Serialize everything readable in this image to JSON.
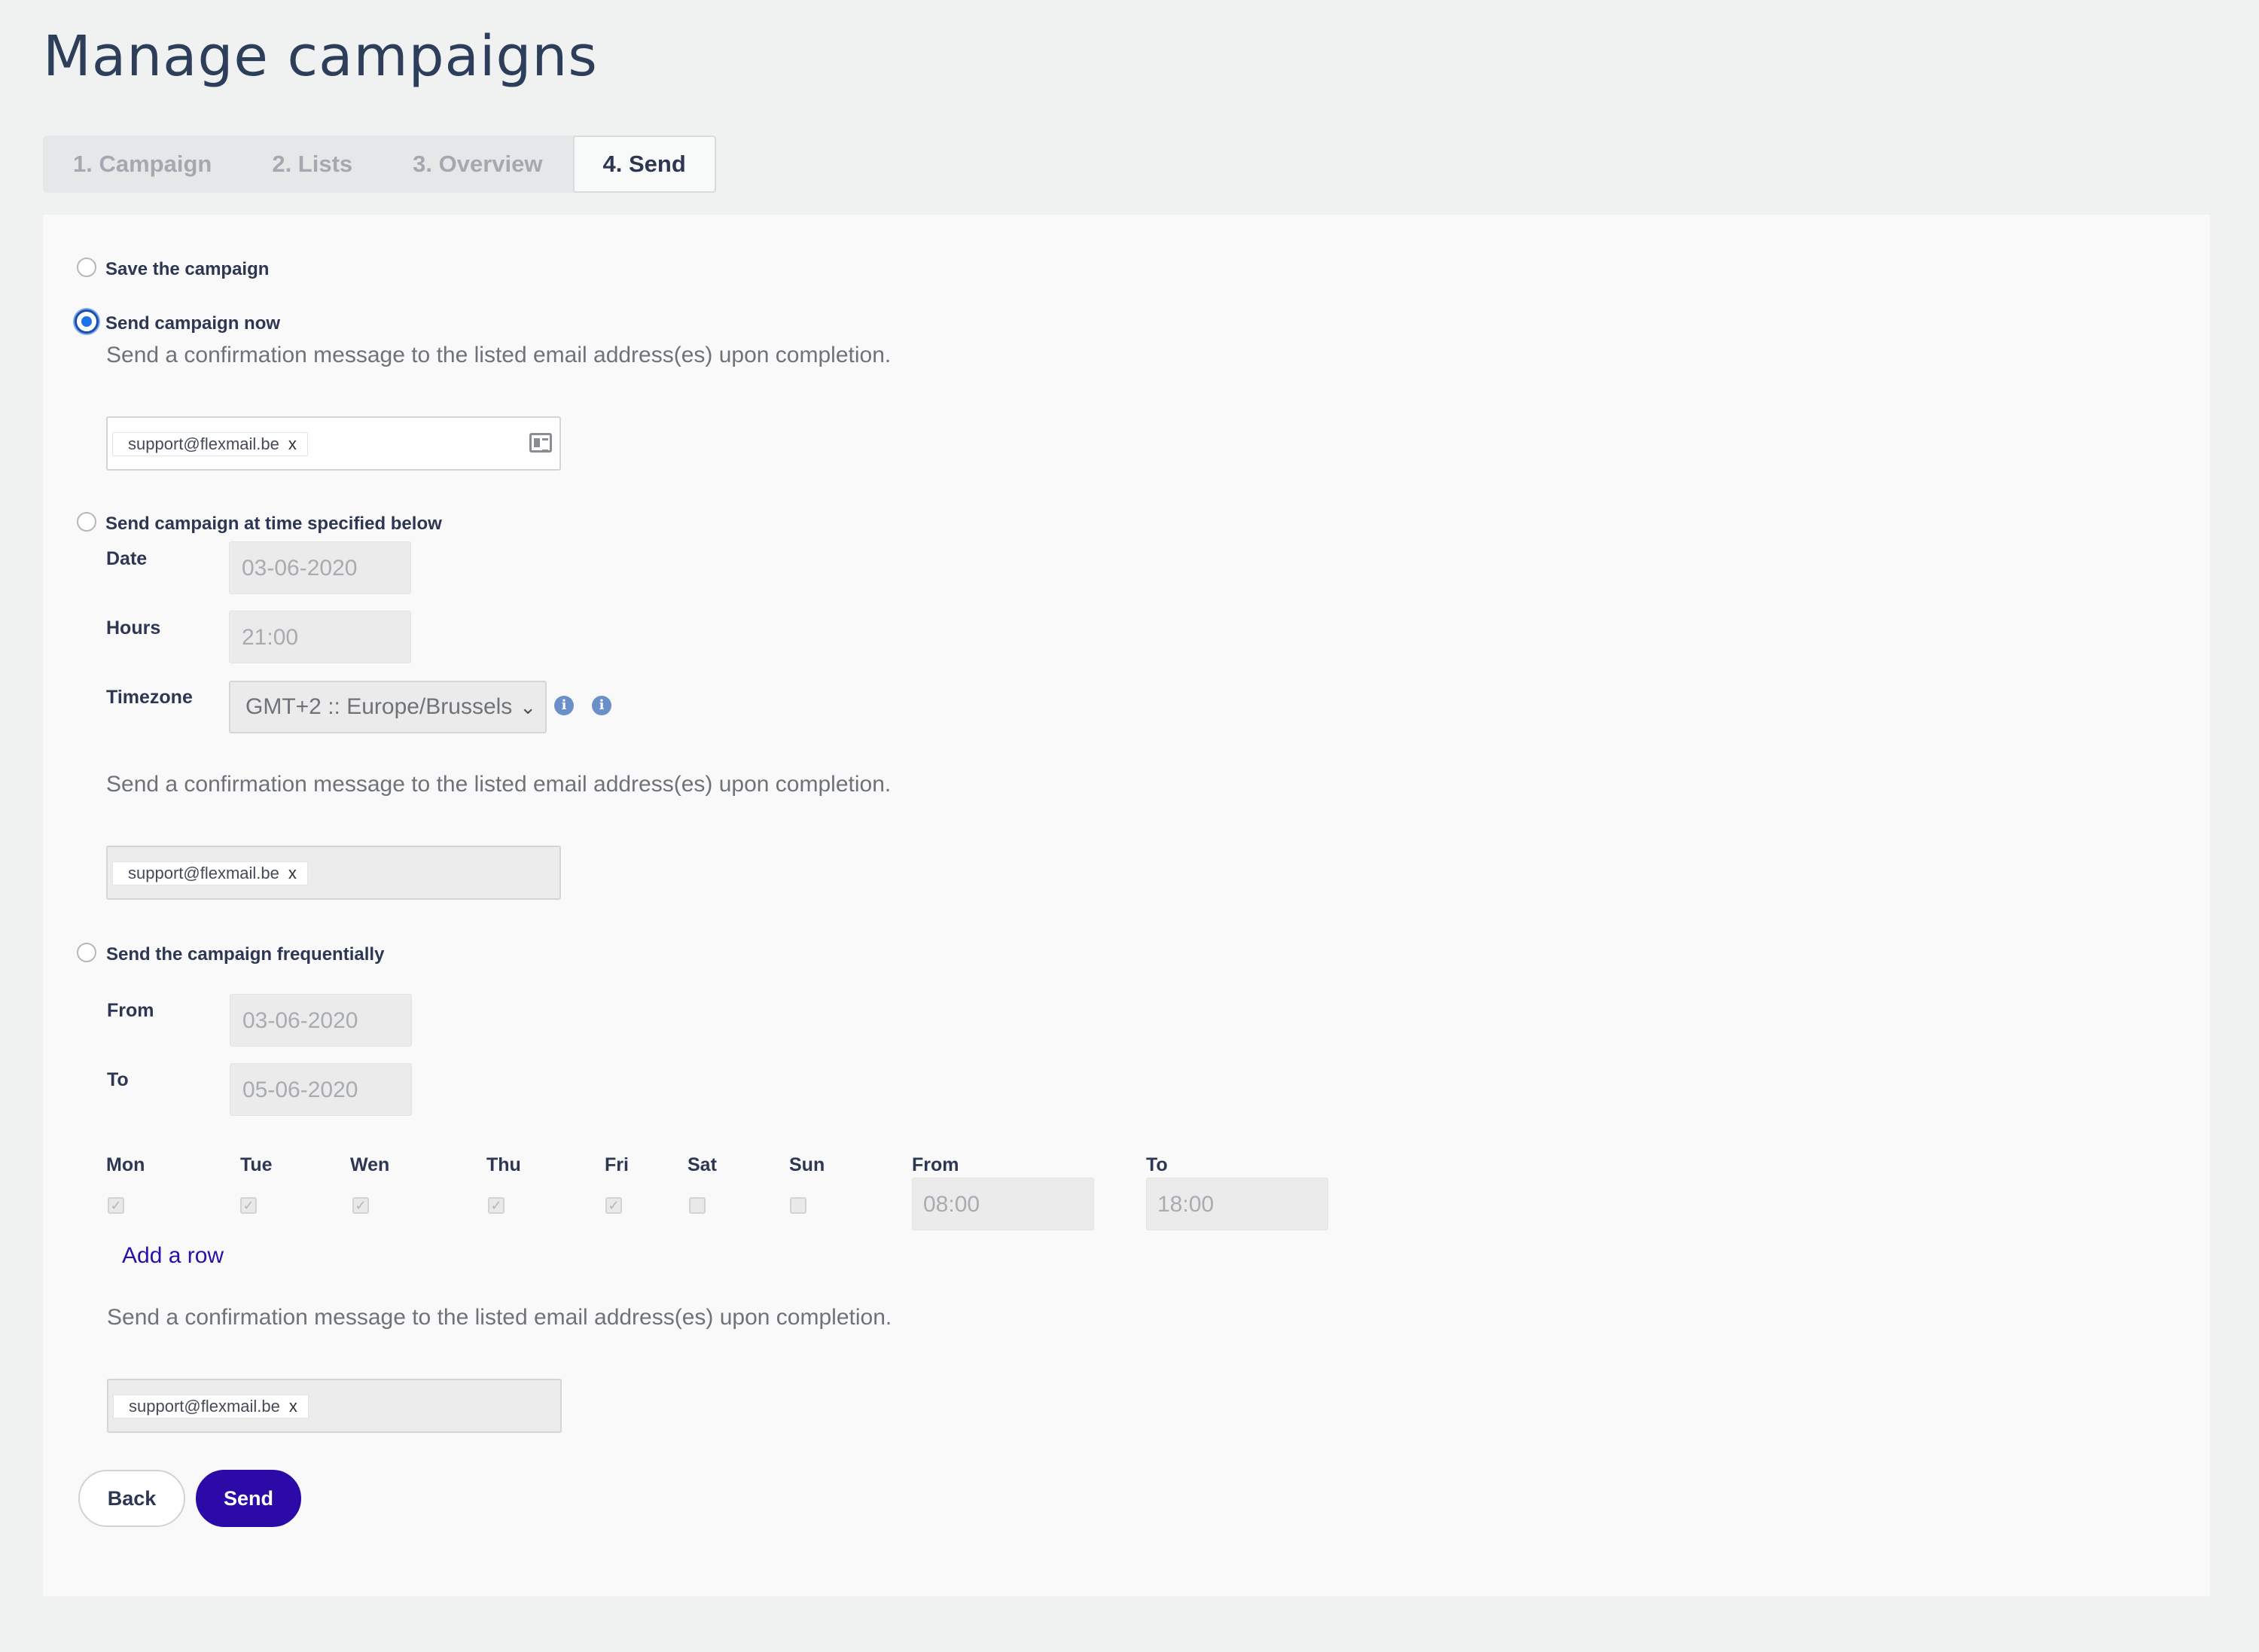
{
  "page": {
    "title": "Manage campaigns"
  },
  "tabs": [
    {
      "label": "1. Campaign",
      "active": false
    },
    {
      "label": "2. Lists",
      "active": false
    },
    {
      "label": "3. Overview",
      "active": false
    },
    {
      "label": "4. Send",
      "active": true
    }
  ],
  "options": {
    "save": {
      "label": "Save the campaign",
      "checked": false
    },
    "send_now": {
      "label": "Send campaign now",
      "checked": true,
      "description": "Send a confirmation message to the listed email address(es) upon completion.",
      "email_tag": "support@flexmail.be",
      "tag_remove": "x"
    },
    "scheduled": {
      "label": "Send campaign at time specified below",
      "checked": false,
      "date_label": "Date",
      "date_value": "03-06-2020",
      "hours_label": "Hours",
      "hours_value": "21:00",
      "timezone_label": "Timezone",
      "timezone_value": "GMT+2 :: Europe/Brussels",
      "info_glyph": "i",
      "description": "Send a confirmation message to the listed email address(es) upon completion.",
      "email_tag": "support@flexmail.be",
      "tag_remove": "x"
    },
    "frequent": {
      "label": "Send the campaign frequentially",
      "checked": false,
      "from_label": "From",
      "from_value": "03-06-2020",
      "to_label": "To",
      "to_value": "05-06-2020",
      "days": [
        {
          "label": "Mon",
          "checked": true
        },
        {
          "label": "Tue",
          "checked": true
        },
        {
          "label": "Wen",
          "checked": true
        },
        {
          "label": "Thu",
          "checked": true
        },
        {
          "label": "Fri",
          "checked": true
        },
        {
          "label": "Sat",
          "checked": false
        },
        {
          "label": "Sun",
          "checked": false
        }
      ],
      "time_from_label": "From",
      "time_from_value": "08:00",
      "time_to_label": "To",
      "time_to_value": "18:00",
      "add_row": "Add a row",
      "description": "Send a confirmation message to the listed email address(es) upon completion.",
      "email_tag": "support@flexmail.be",
      "tag_remove": "x"
    }
  },
  "buttons": {
    "back": "Back",
    "send": "Send"
  },
  "icons": {
    "contacts": "contact-card-icon",
    "info": "info-icon",
    "check": "✓",
    "chevron": "⌄"
  },
  "colors": {
    "primary": "#2b0aa8",
    "radio_selected": "#1a73e8",
    "link": "#2a0fa8"
  }
}
